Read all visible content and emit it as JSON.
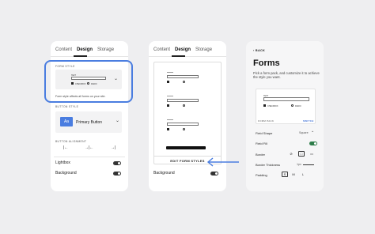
{
  "tabs": [
    "Content",
    "Design",
    "Storage"
  ],
  "panel1": {
    "form_style_label": "FORM STYLE",
    "form_style_note": "Form style affects all forms on your site.",
    "mini_text": "TEXT",
    "mini_checkbox": "CHECKBOX",
    "mini_radio": "RADIO",
    "button_style_label": "BUTTON STYLE",
    "button_sample": "Aa",
    "button_name": "Primary Button",
    "button_alignment_label": "BUTTON ALIGNMENT",
    "align_left": "|←",
    "align_center": "→|←",
    "align_right": "→|",
    "lightbox": "Lightbox",
    "background": "Background"
  },
  "panel2": {
    "edit_button": "EDIT FORM STYLES",
    "background": "Background"
  },
  "panel3": {
    "back": "BACK",
    "title": "Forms",
    "description": "Pick a form pack, and customize it to achieve the style you want.",
    "form_pack_label": "FORM PACK",
    "switch_label": "SWITCH",
    "field_shape": "Field Shape",
    "field_shape_value": "Square",
    "field_fill": "Field Fill",
    "border": "Border",
    "border_thickness": "Border Thickness",
    "border_thickness_value": "1px",
    "padding": "Padding",
    "padding_options": [
      "S",
      "M",
      "L"
    ]
  },
  "colors": {
    "accent": "#4a7de0",
    "toggle_on": "#2e7d4a",
    "link": "#3d6fd6"
  }
}
